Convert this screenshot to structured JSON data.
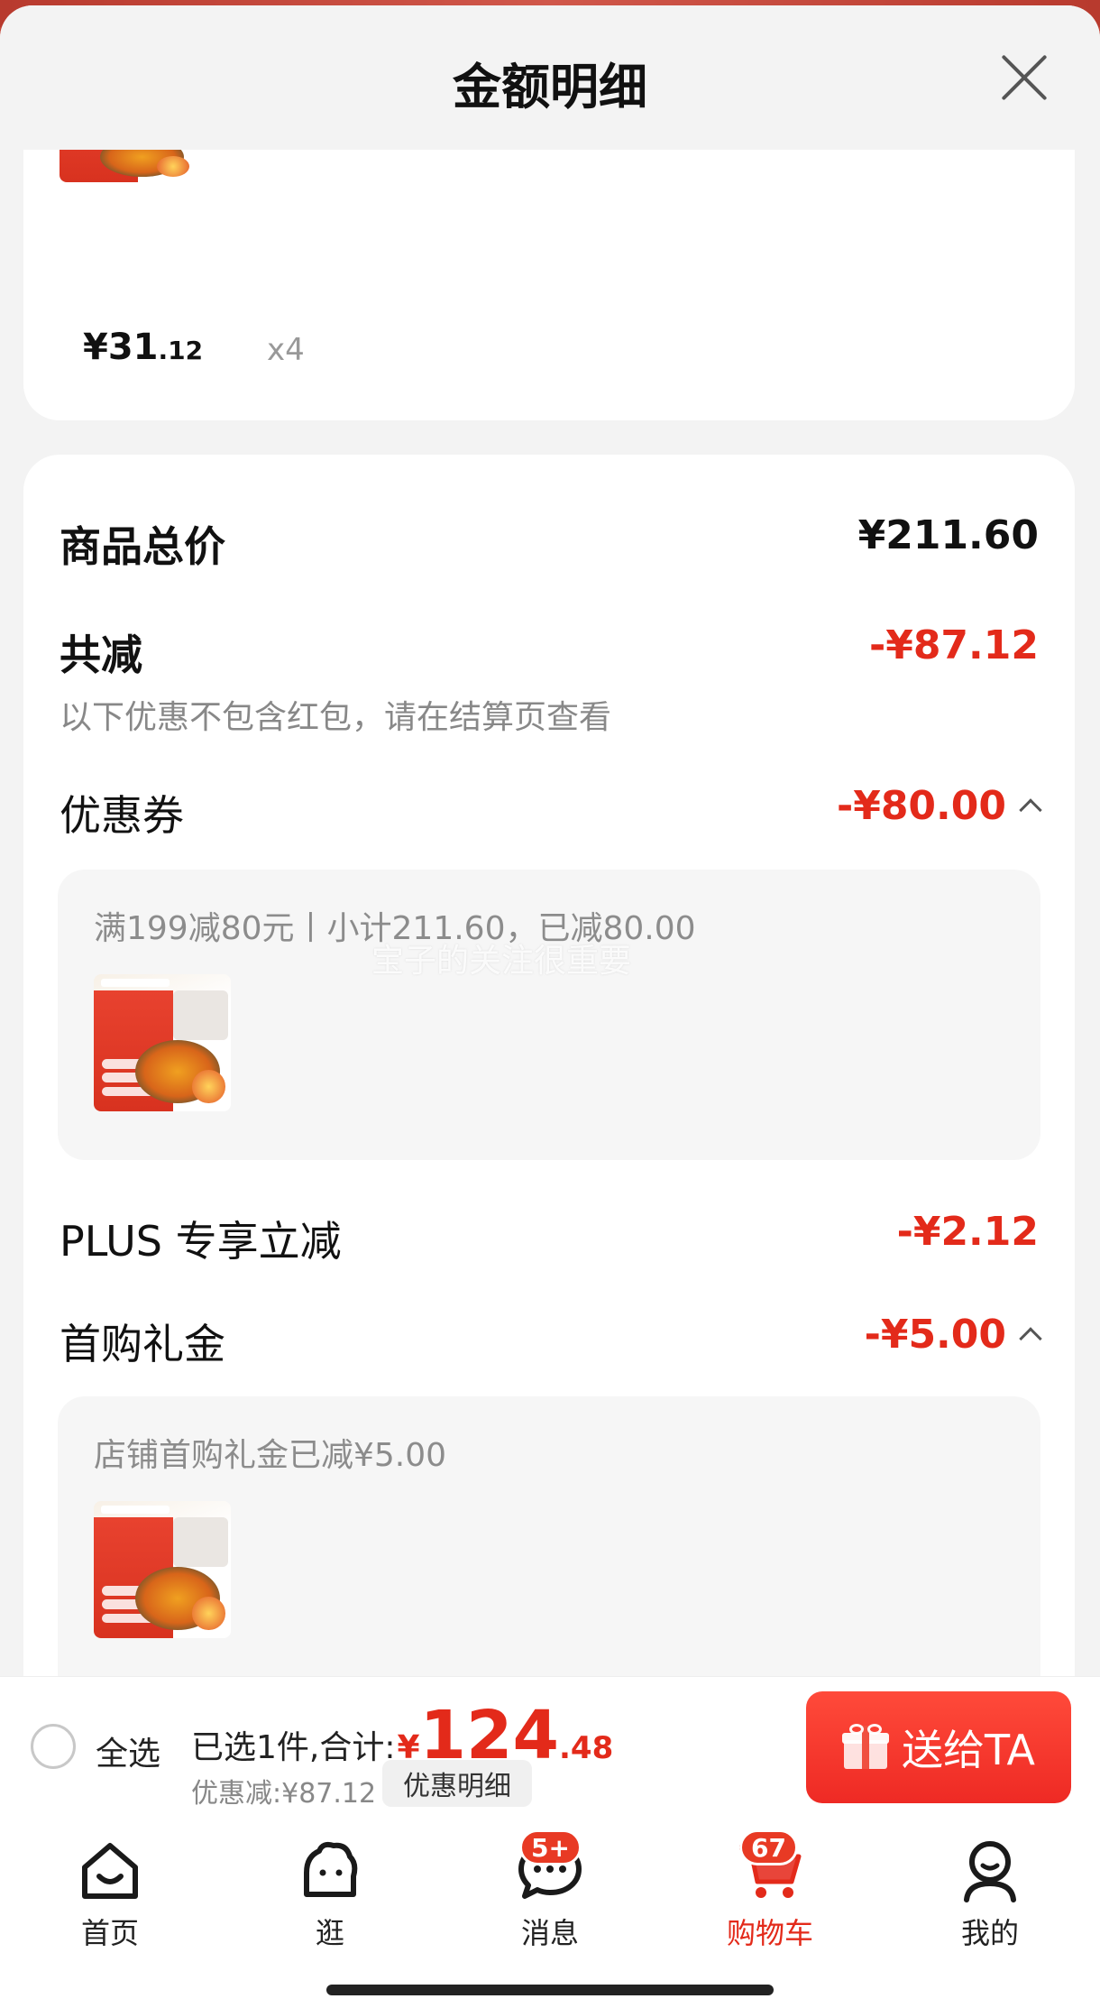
{
  "header": {
    "title": "金额明细"
  },
  "top_item": {
    "price_int": "¥31",
    "price_dec": ".12",
    "quantity": "x4"
  },
  "summary": {
    "total_label": "商品总价",
    "total_value": "¥211.60",
    "discount_label": "共减",
    "discount_value": "-¥87.12",
    "note": "以下优惠不包含红包，请在结算页查看"
  },
  "coupon": {
    "label": "优惠券",
    "value": "-¥80.00",
    "detail": "满199减80元丨小计211.60，已减80.00"
  },
  "plus": {
    "label": "PLUS 专享立减",
    "value": "-¥2.12"
  },
  "first_purchase": {
    "label": "首购礼金",
    "value": "-¥5.00",
    "detail": "店铺首购礼金已减¥5.00"
  },
  "watermark": "宝子的关注很重要",
  "checkout": {
    "select_all": "全选",
    "selected_text": "已选1件,合计:",
    "total_yen": "¥",
    "total_int": "124",
    "total_dec": ".48",
    "discount_text": "优惠减:¥87.12",
    "discount_detail_button": "优惠明细",
    "gift_button": "送给TA"
  },
  "tabs": [
    {
      "label": "首页",
      "icon": "home-icon",
      "badge": ""
    },
    {
      "label": "逛",
      "icon": "browse-icon",
      "badge": ""
    },
    {
      "label": "消息",
      "icon": "message-icon",
      "badge": "5+"
    },
    {
      "label": "购物车",
      "icon": "cart-icon",
      "badge": "67"
    },
    {
      "label": "我的",
      "icon": "profile-icon",
      "badge": ""
    }
  ],
  "colors": {
    "accent": "#e32a1a",
    "background": "#f3f3f3"
  }
}
